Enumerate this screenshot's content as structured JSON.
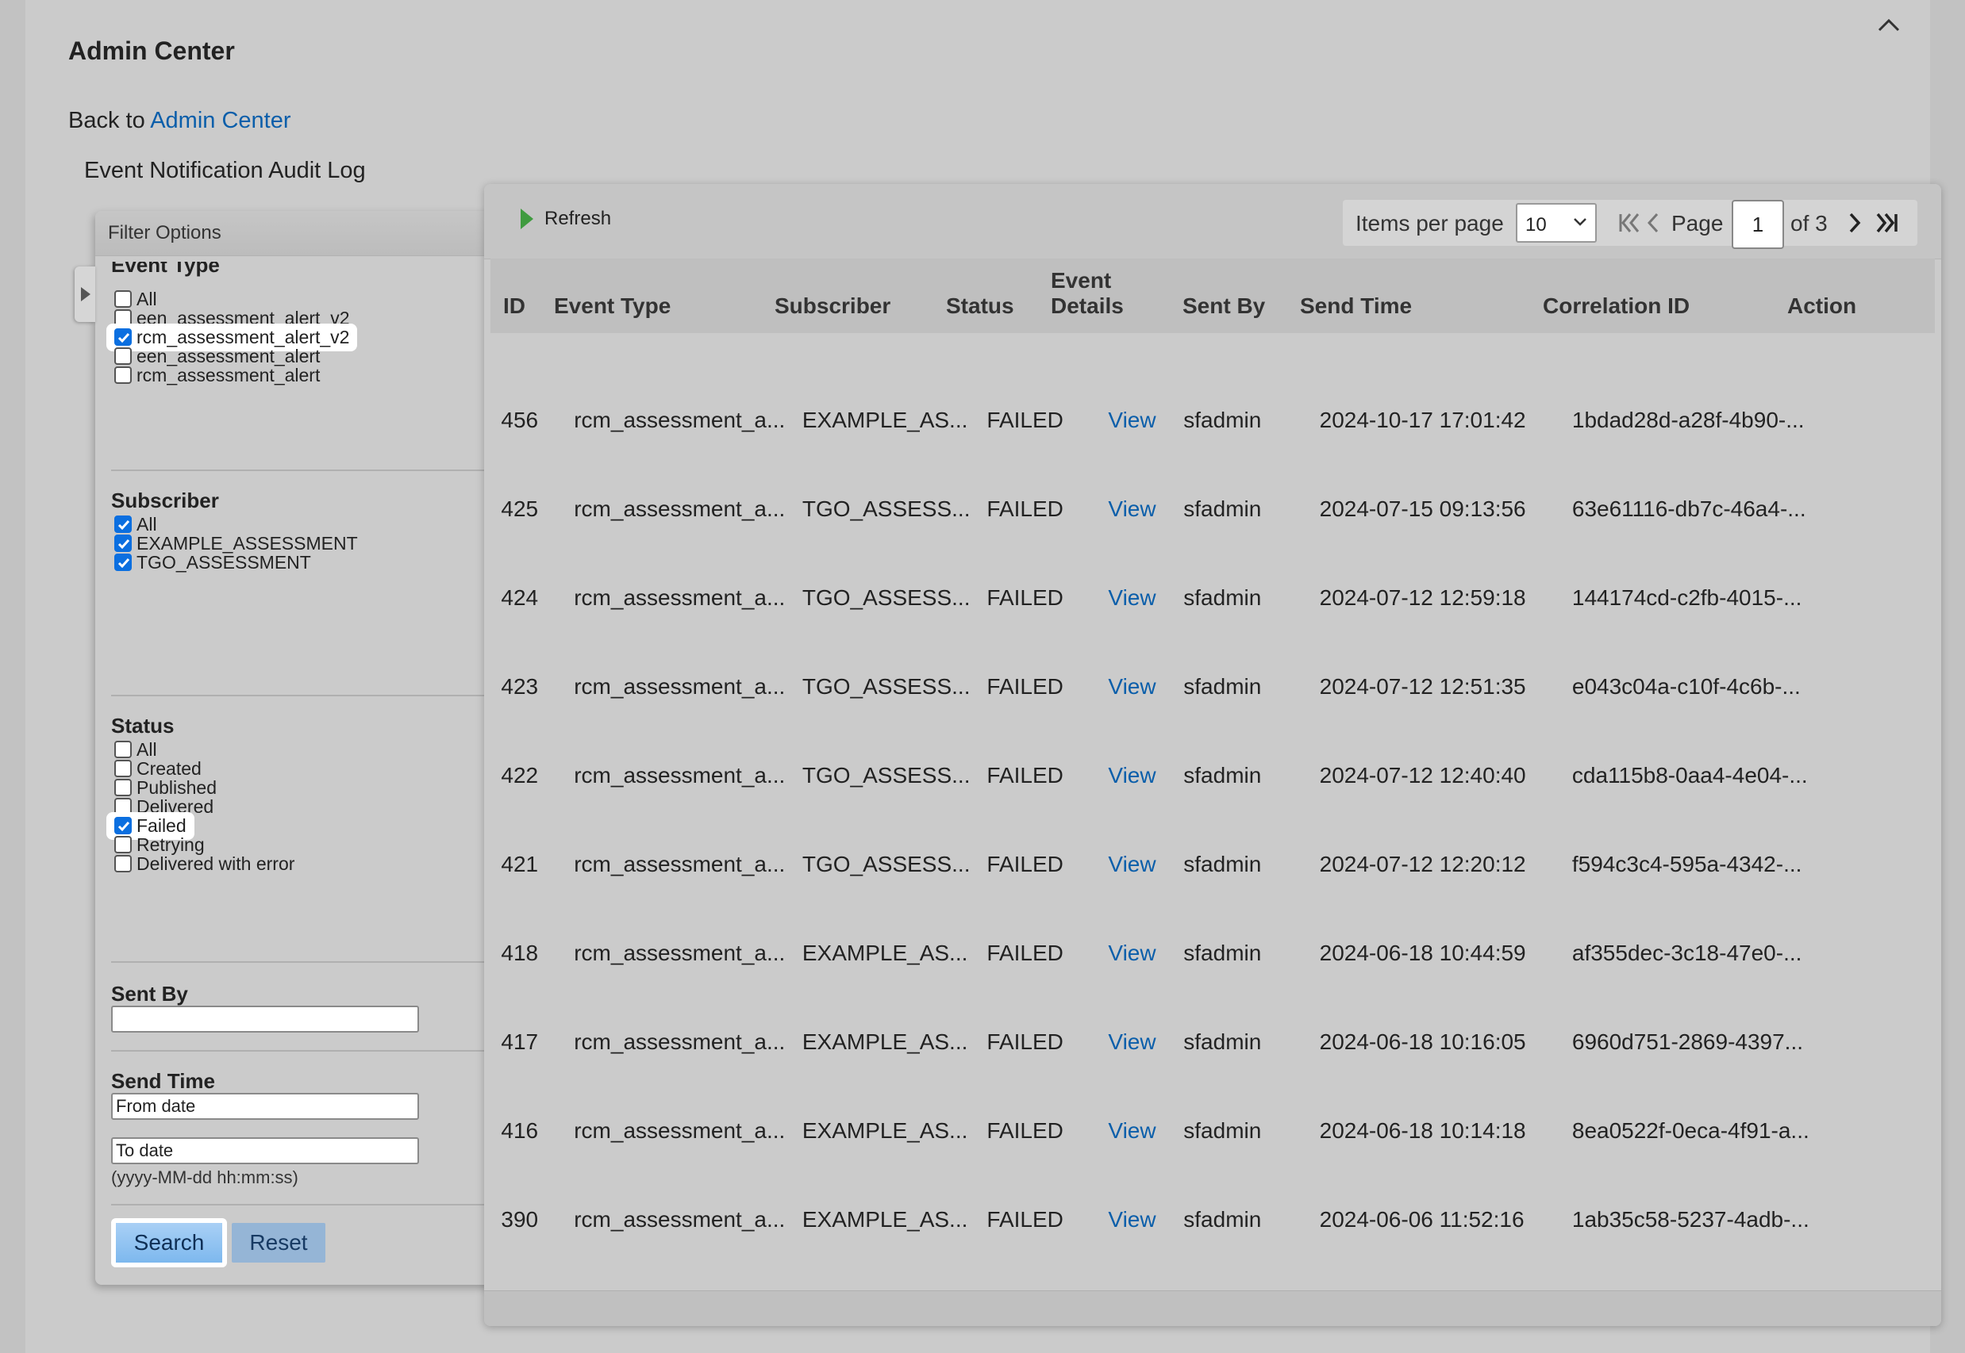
{
  "header": {
    "title": "Admin Center",
    "back_prefix": "Back to",
    "back_link": "Admin Center",
    "subtitle": "Event Notification Audit Log"
  },
  "filter": {
    "header": "Filter Options",
    "event_type": {
      "title": "Event Type",
      "items": [
        {
          "label": "All",
          "checked": false
        },
        {
          "label": "een_assessment_alert_v2",
          "checked": false
        },
        {
          "label": "rcm_assessment_alert_v2",
          "checked": true
        },
        {
          "label": "een_assessment_alert",
          "checked": false
        },
        {
          "label": "rcm_assessment_alert",
          "checked": false
        }
      ]
    },
    "subscriber": {
      "title": "Subscriber",
      "items": [
        {
          "label": "All",
          "checked": true
        },
        {
          "label": "EXAMPLE_ASSESSMENT",
          "checked": true
        },
        {
          "label": "TGO_ASSESSMENT",
          "checked": true
        }
      ]
    },
    "status": {
      "title": "Status",
      "items": [
        {
          "label": "All",
          "checked": false
        },
        {
          "label": "Created",
          "checked": false
        },
        {
          "label": "Published",
          "checked": false
        },
        {
          "label": "Delivered",
          "checked": false
        },
        {
          "label": "Failed",
          "checked": true
        },
        {
          "label": "Retrying",
          "checked": false
        },
        {
          "label": "Delivered with error",
          "checked": false
        }
      ]
    },
    "sent_by": {
      "title": "Sent By",
      "value": ""
    },
    "send_time": {
      "title": "Send Time",
      "from_placeholder": "From date",
      "to_placeholder": "To date",
      "hint": "(yyyy-MM-dd hh:mm:ss)"
    },
    "search_label": "Search",
    "reset_label": "Reset"
  },
  "toolbar": {
    "refresh_label": "Refresh",
    "items_per_page_label": "Items per page",
    "items_per_page": "10",
    "page_label": "Page",
    "page": "1",
    "of_label": "of 3"
  },
  "table": {
    "columns": [
      "ID",
      "Event Type",
      "Subscriber",
      "Status",
      "Event",
      "Details",
      "Sent By",
      "Send Time",
      "Correlation ID",
      "Action"
    ],
    "rows": [
      [
        "456",
        "rcm_assessment_a...",
        "EXAMPLE_AS...",
        "FAILED",
        "View",
        "sfadmin",
        "2024-10-17 17:01:42",
        "1bdad28d-a28f-4b90-..."
      ],
      [
        "425",
        "rcm_assessment_a...",
        "TGO_ASSESS...",
        "FAILED",
        "View",
        "sfadmin",
        "2024-07-15 09:13:56",
        "63e61116-db7c-46a4-..."
      ],
      [
        "424",
        "rcm_assessment_a...",
        "TGO_ASSESS...",
        "FAILED",
        "View",
        "sfadmin",
        "2024-07-12 12:59:18",
        "144174cd-c2fb-4015-..."
      ],
      [
        "423",
        "rcm_assessment_a...",
        "TGO_ASSESS...",
        "FAILED",
        "View",
        "sfadmin",
        "2024-07-12 12:51:35",
        "e043c04a-c10f-4c6b-..."
      ],
      [
        "422",
        "rcm_assessment_a...",
        "TGO_ASSESS...",
        "FAILED",
        "View",
        "sfadmin",
        "2024-07-12 12:40:40",
        "cda115b8-0aa4-4e04-..."
      ],
      [
        "421",
        "rcm_assessment_a...",
        "TGO_ASSESS...",
        "FAILED",
        "View",
        "sfadmin",
        "2024-07-12 12:20:12",
        "f594c3c4-595a-4342-..."
      ],
      [
        "418",
        "rcm_assessment_a...",
        "EXAMPLE_AS...",
        "FAILED",
        "View",
        "sfadmin",
        "2024-06-18 10:44:59",
        "af355dec-3c18-47e0-..."
      ],
      [
        "417",
        "rcm_assessment_a...",
        "EXAMPLE_AS...",
        "FAILED",
        "View",
        "sfadmin",
        "2024-06-18 10:16:05",
        "6960d751-2869-4397..."
      ],
      [
        "416",
        "rcm_assessment_a...",
        "EXAMPLE_AS...",
        "FAILED",
        "View",
        "sfadmin",
        "2024-06-18 10:14:18",
        "8ea0522f-0eca-4f91-a..."
      ],
      [
        "390",
        "rcm_assessment_a...",
        "EXAMPLE_AS...",
        "FAILED",
        "View",
        "sfadmin",
        "2024-06-06 11:52:16",
        "1ab35c58-5237-4adb-..."
      ]
    ]
  },
  "colors": {
    "link": "#0a5eaa",
    "checkbox": "#0b6fe0",
    "refresh_icon": "#3f9b3f"
  },
  "icons": [
    "chevron-up-icon",
    "expand-arrow-icon",
    "play-icon",
    "chevron-down-icon",
    "first-page-icon",
    "prev-page-icon",
    "next-page-icon",
    "last-page-icon"
  ]
}
